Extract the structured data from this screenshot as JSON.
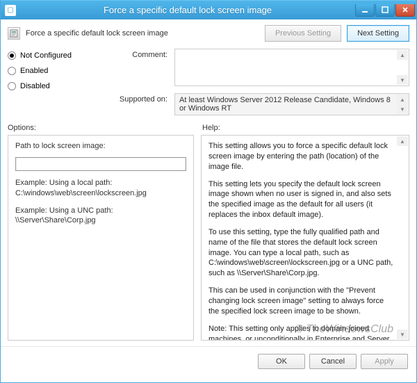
{
  "window": {
    "title": "Force a specific default lock screen image"
  },
  "header": {
    "policy_title": "Force a specific default lock screen image",
    "prev_label": "Previous Setting",
    "next_label": "Next Setting"
  },
  "state": {
    "radios": {
      "not_configured": "Not Configured",
      "enabled": "Enabled",
      "disabled": "Disabled",
      "selected": "not_configured"
    },
    "comment_label": "Comment:",
    "comment_value": "",
    "supported_label": "Supported on:",
    "supported_value": "At least Windows Server 2012 Release Candidate, Windows 8 or Windows RT"
  },
  "labels": {
    "options": "Options:",
    "help": "Help:"
  },
  "options": {
    "path_label": "Path to lock screen image:",
    "path_value": "",
    "example_local_h": "Example: Using a local path:",
    "example_local_v": "C:\\windows\\web\\screen\\lockscreen.jpg",
    "example_unc_h": "Example: Using a UNC path:",
    "example_unc_v": "\\\\Server\\Share\\Corp.jpg"
  },
  "help": {
    "p1": "This setting allows you to force a specific default lock screen image by entering the path (location) of the image file.",
    "p2": "This setting lets you specify the default lock screen image shown when no user is signed in, and also sets the specified image as the default for all users (it replaces the inbox default image).",
    "p3": "To use this setting, type the fully qualified path and name of the file that stores the default lock screen image. You can type a local path, such as C:\\windows\\web\\screen\\lockscreen.jpg or a UNC path, such as \\\\Server\\Share\\Corp.jpg.",
    "p4": "This can be used in conjunction with the \"Prevent changing lock screen image\" setting to always force the specified lock screen image to be shown.",
    "p5": "Note: This setting only applies to domain-joined machines, or unconditionally in Enterprise and Server SKUs."
  },
  "buttons": {
    "ok": "OK",
    "cancel": "Cancel",
    "apply": "Apply"
  },
  "watermark": "© TheWindowsClub"
}
